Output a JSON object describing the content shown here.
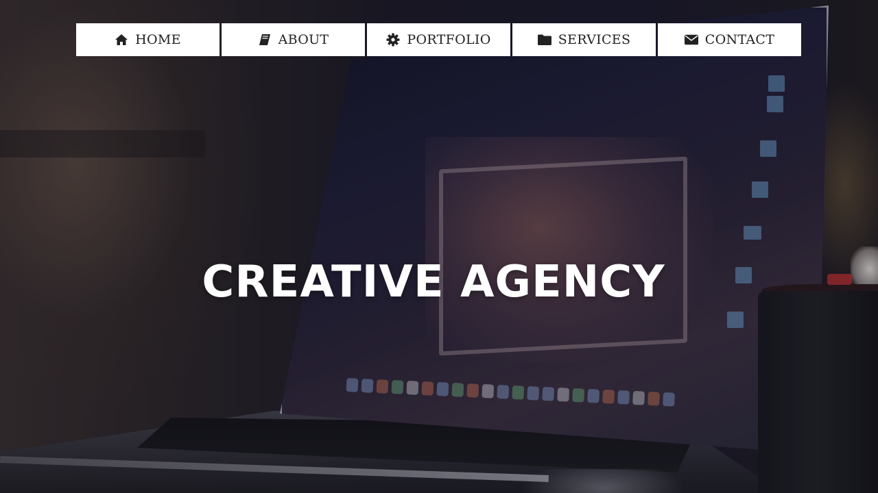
{
  "nav": {
    "items": [
      {
        "label": "HOME",
        "icon": "home-icon"
      },
      {
        "label": "ABOUT",
        "icon": "book-icon"
      },
      {
        "label": "PORTFOLIO",
        "icon": "gear-icon"
      },
      {
        "label": "SERVICES",
        "icon": "folder-icon"
      },
      {
        "label": "CONTACT",
        "icon": "envelope-icon"
      }
    ]
  },
  "hero": {
    "headline": "CREATIVE AGENCY"
  },
  "colors": {
    "nav_background": "#ffffff",
    "nav_text": "#222222",
    "headline": "#ffffff"
  }
}
